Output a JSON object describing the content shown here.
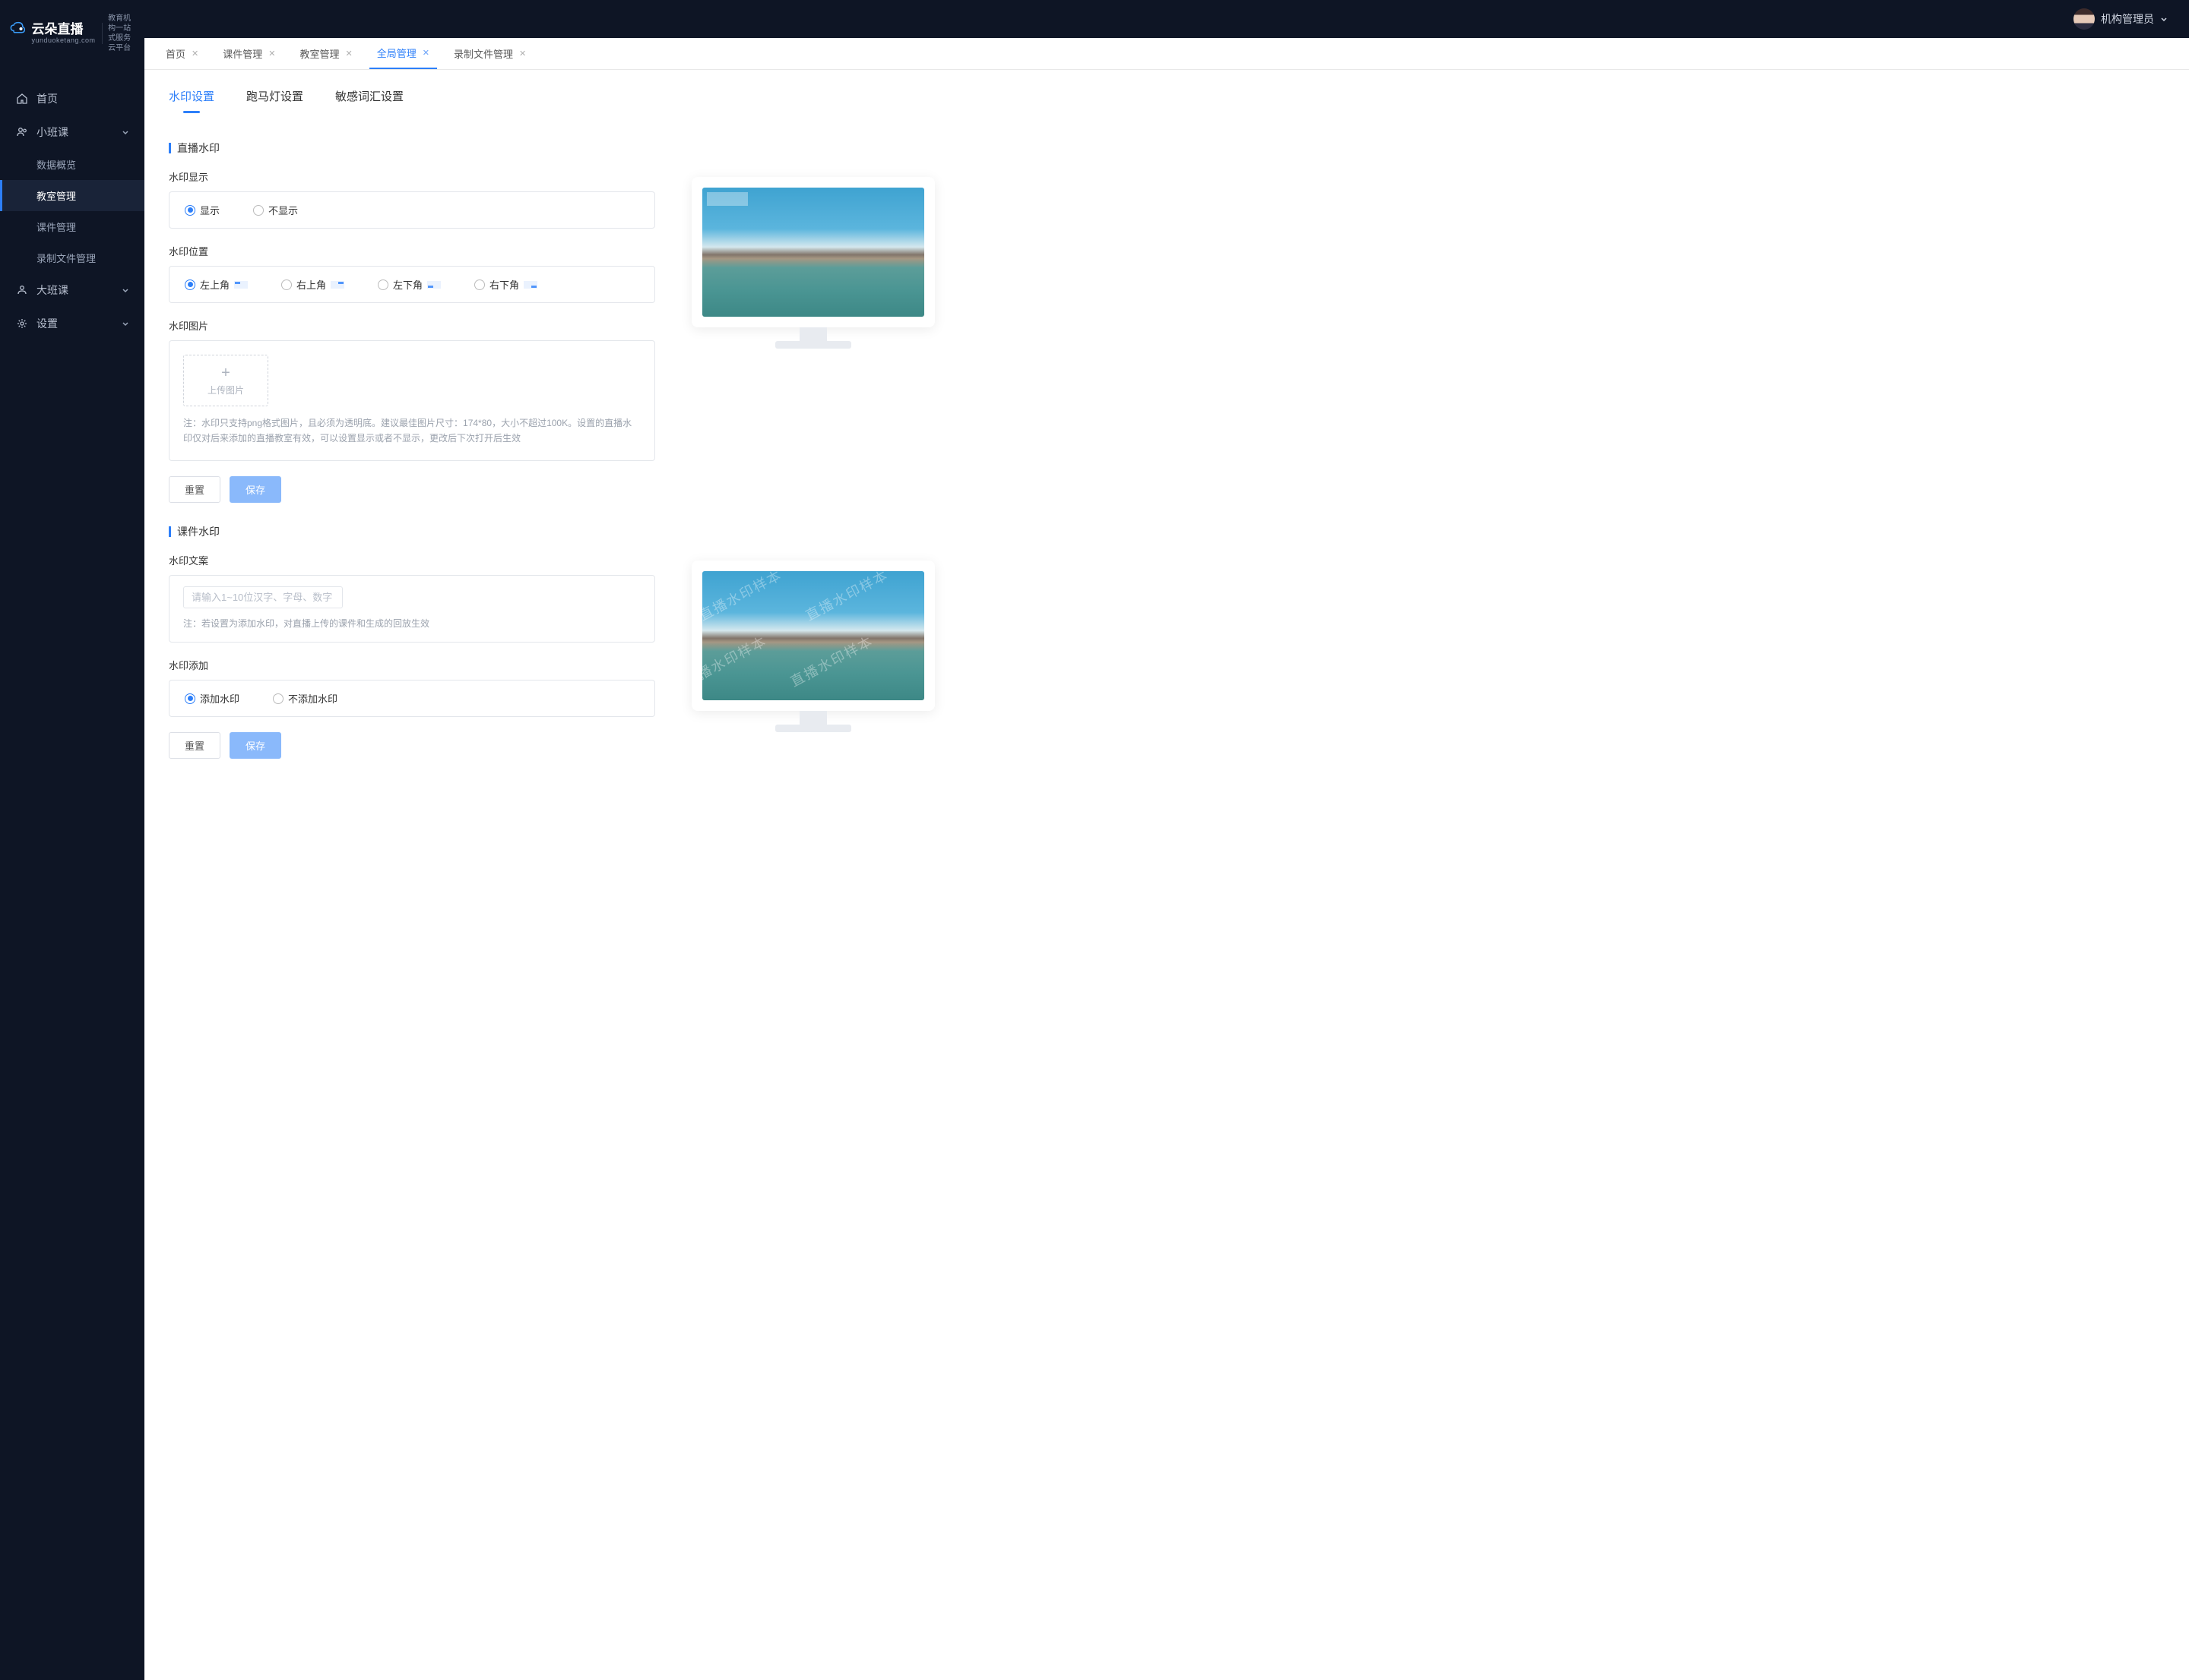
{
  "brand": {
    "name": "云朵直播",
    "domain": "yunduoketang.com",
    "tagline_l1": "教育机构一站",
    "tagline_l2": "式服务云平台"
  },
  "user": {
    "name": "机构管理员"
  },
  "sidebar": {
    "home": "首页",
    "small_class": {
      "label": "小班课",
      "children": [
        "数据概览",
        "教室管理",
        "课件管理",
        "录制文件管理"
      ],
      "active_index": 1
    },
    "big_class": "大班课",
    "settings": "设置"
  },
  "tabs": [
    {
      "label": "首页",
      "closable": true
    },
    {
      "label": "课件管理",
      "closable": true
    },
    {
      "label": "教室管理",
      "closable": true
    },
    {
      "label": "全局管理",
      "closable": true,
      "active": true
    },
    {
      "label": "录制文件管理",
      "closable": true
    }
  ],
  "sub_tabs": {
    "watermark": "水印设置",
    "marquee": "跑马灯设置",
    "sensitive": "敏感词汇设置",
    "active": "watermark"
  },
  "live_wm": {
    "title": "直播水印",
    "display_label": "水印显示",
    "display_opts": {
      "show": "显示",
      "hide": "不显示"
    },
    "position_label": "水印位置",
    "position_opts": {
      "tl": "左上角",
      "tr": "右上角",
      "bl": "左下角",
      "br": "右下角"
    },
    "image_label": "水印图片",
    "upload_label": "上传图片",
    "note": "注：水印只支持png格式图片，且必须为透明底。建议最佳图片尺寸：174*80，大小不超过100K。设置的直播水印仅对后来添加的直播教室有效，可以设置显示或者不显示，更改后下次打开后生效",
    "reset_btn": "重置",
    "save_btn": "保存"
  },
  "course_wm": {
    "title": "课件水印",
    "text_label": "水印文案",
    "text_placeholder": "请输入1~10位汉字、字母、数字",
    "note": "注：若设置为添加水印，对直播上传的课件和生成的回放生效",
    "add_label": "水印添加",
    "add_opts": {
      "yes": "添加水印",
      "no": "不添加水印"
    },
    "reset_btn": "重置",
    "save_btn": "保存",
    "sample_text": "直播水印样本"
  }
}
